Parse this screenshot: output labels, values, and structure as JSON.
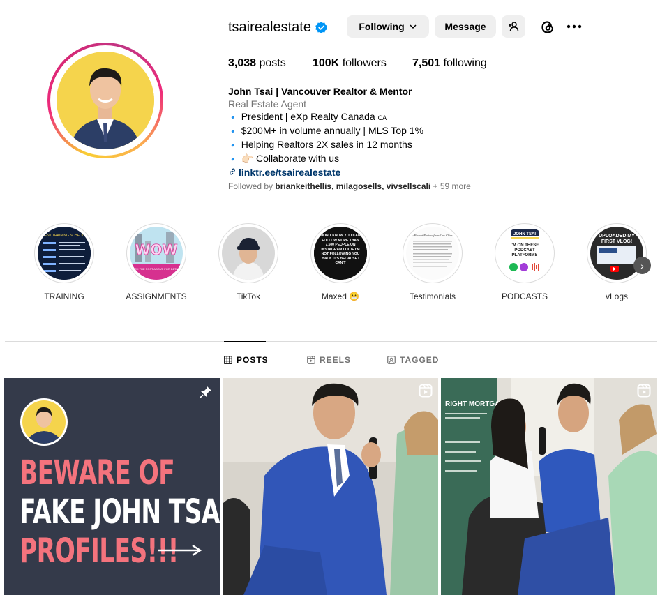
{
  "profile": {
    "username": "tsairealestate",
    "buttons": {
      "following": "Following",
      "message": "Message"
    },
    "stats": {
      "posts_count": "3,038",
      "posts_label": " posts",
      "followers_count": "100K",
      "followers_label": " followers",
      "following_count": "7,501",
      "following_label": " following"
    },
    "bio": {
      "name": "John Tsai | Vancouver Realtor & Mentor",
      "category": "Real Estate Agent",
      "lines": [
        "President | eXp Realty Canada",
        "$200M+ in volume annually | MLS Top 1%",
        "Helping Realtors 2X sales in 12 months",
        "👉🏻 Collaborate with us"
      ],
      "country_tag": "CA",
      "bullet": "🔹",
      "link": "linktr.ee/tsairealestate"
    },
    "followed_by": {
      "prefix": "Followed by ",
      "names": "briankeithellis, milagosells, vivsellscali",
      "more": " + 59 more"
    }
  },
  "highlights": [
    {
      "label": "TRAINING"
    },
    {
      "label": "ASSIGNMENTS"
    },
    {
      "label": "TikTok"
    },
    {
      "label": "Maxed 😬"
    },
    {
      "label": "Testimonials"
    },
    {
      "label": "PODCASTS"
    },
    {
      "label": "vLogs"
    }
  ],
  "highlight_art": {
    "training_title": "AGENT TRAINING SCHEDULE",
    "assign_word": "WOW",
    "assign_caption": "CLICK THE POST ABOVE FOR DETAILS",
    "maxed_text": "DON'T KNOW YOU CAN FOLLOW MORE THAN 7,500 PEOPLE ON INSTAGRAM LOL IF I'M NOT FOLLOWING YOU BACK IT'S BECAUSE I CAN'T",
    "testimonial_title": "A Recent Review from Our Client",
    "podcast_name": "JOHN TSAI",
    "podcast_text": "I'M ON THESE PODCAST PLATFORMS",
    "vlog_text": "UPLOADED MY FIRST VLOG!"
  },
  "tabs": {
    "posts": "POSTS",
    "reels": "REELS",
    "tagged": "TAGGED"
  },
  "posts": {
    "post1_lines": [
      "BEWARE OF",
      "FAKE JOHN TSAI",
      "PROFILES!!!"
    ],
    "post3_sign": "RIGHT MORTGAGE"
  },
  "colors": {
    "verified": "#0095f6",
    "link": "#00376b",
    "post_pink": "#f4737d",
    "post_bg": "#343a4a"
  }
}
